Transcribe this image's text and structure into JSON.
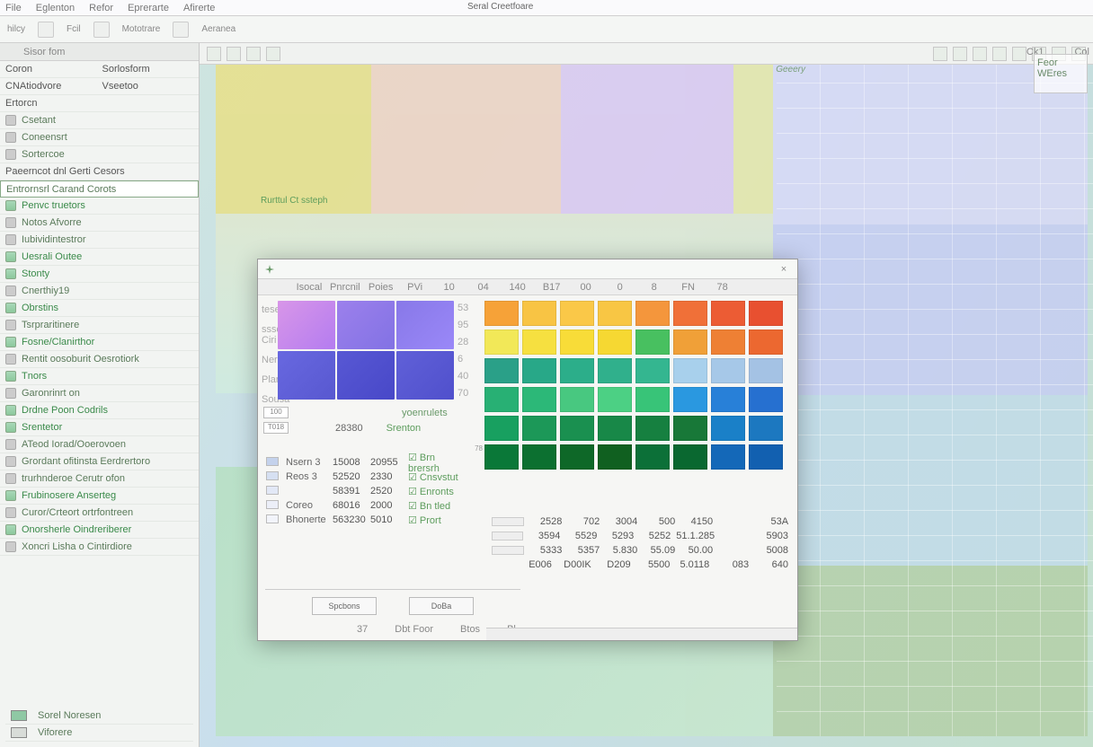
{
  "app_title": "Seral Creetfoare",
  "menu": [
    "File",
    "Eglenton",
    "Refor",
    "Eprerarte",
    "Afirerte"
  ],
  "toolbar_labels": [
    "Fcil",
    "Mototrare",
    "Aeranea"
  ],
  "leftpane": {
    "header": {
      "a": "Sisor fom",
      "b": ""
    },
    "pairs": [
      {
        "a": "Coron",
        "b": "Sorlosform"
      },
      {
        "a": "CNAtiodvore",
        "b": "Vseetoo"
      }
    ],
    "items": [
      {
        "label": "Ertorcn",
        "type": "hdr"
      },
      {
        "label": "Csetant",
        "icon": true
      },
      {
        "label": "Coneensrt",
        "icon": true
      },
      {
        "label": "Sortercoe",
        "icon": true
      },
      {
        "label": "Paeerncot dnl Gerti Cesors",
        "type": "hdr"
      },
      {
        "label": "Entrornsrl Carand Corots",
        "sel": true
      },
      {
        "label": "Penvc truetors",
        "green": true,
        "icon": true
      },
      {
        "label": "Notos Afvorre",
        "icon": true
      },
      {
        "label": "Iubividintestror",
        "icon": true
      },
      {
        "label": "Uesrali Outee",
        "green": true,
        "icon": true
      },
      {
        "label": "Stonty",
        "green": true,
        "icon": true
      },
      {
        "label": "Cnerthiy19",
        "icon": true
      },
      {
        "label": "Obrstins",
        "green": true,
        "icon": true
      },
      {
        "label": "Tsrpraritinere",
        "icon": true
      },
      {
        "label": "Fosne/Clanirthor",
        "green": true,
        "icon": true
      },
      {
        "label": "Rentit oosoburit Oesrotiork",
        "icon": true
      },
      {
        "label": "Tnors",
        "green": true,
        "icon": true
      },
      {
        "label": "Garonrinrt on",
        "icon": true
      },
      {
        "label": "Drdne Poon Codrils",
        "green": true,
        "icon": true
      },
      {
        "label": "Srentetor",
        "green": true,
        "icon": true
      },
      {
        "label": "ATeod Iorad/Ooerovoen",
        "icon": true
      },
      {
        "label": "Grordant ofitinsta Eerdrertoro",
        "icon": true
      },
      {
        "label": "trurhnderoe Cerutr ofon",
        "icon": true
      },
      {
        "label": "Frubinosere Anserteg",
        "green": true,
        "icon": true
      },
      {
        "label": "Curor/Crteort ortrfontreen",
        "icon": true
      },
      {
        "label": "Onorsherle Oindreriberer",
        "green": true,
        "icon": true
      },
      {
        "label": "Xoncri Lisha o Cintirdiore",
        "icon": true
      }
    ],
    "bottom": [
      {
        "label": "Sorel Noresen"
      },
      {
        "label": "Viforere"
      }
    ]
  },
  "rightmini": {
    "a": "Feor",
    "b": "WEres"
  },
  "catlabel": "Geeery",
  "colhdrs": [
    "Ck1",
    "Col"
  ],
  "sectag": "Rurttul Ct ssteph",
  "dialog": {
    "hdrcells": [
      "",
      "Isocal",
      "Pnrcnil",
      "Poies",
      "PVi",
      "10",
      "04",
      "140",
      "B17",
      "00",
      "0",
      "8",
      "FN",
      "78"
    ],
    "sidelabels": [
      "teserrol",
      "sssd Ciri",
      "Neres",
      "Plantel",
      "Sousa"
    ],
    "list_nums": [
      "53",
      "95",
      "28",
      "6",
      "40",
      "70"
    ],
    "optrow": {
      "v": "100",
      "hdr": "yoenrulets"
    },
    "btmhead": [
      "T018",
      "28380",
      "",
      "Srenton"
    ],
    "table": [
      {
        "sw": "#c4d2ec",
        "c1": "Nsern 3",
        "c2": "15008",
        "c3": "20955",
        "c4": "Brn brersrh"
      },
      {
        "sw": "#d6e0f2",
        "c1": "Reos 3",
        "c2": "52520",
        "c3": "2330",
        "c4": "Cnsvstut"
      },
      {
        "sw": "#e2e8f6",
        "c1": "",
        "c2": "58391",
        "c3": "2520",
        "c4": "Enronts"
      },
      {
        "sw": "#eceff8",
        "c1": "Coreo",
        "c2": "68016",
        "c3": "2000",
        "c4": "Bn tled"
      },
      {
        "sw": "#f2f4fa",
        "c1": "Bhonerte",
        "c2": "563230",
        "c3": "5010",
        "c4": "Prort"
      }
    ],
    "buttons": [
      "Spcbons",
      "DoBa"
    ],
    "buttons2": [
      "Dbt Foor",
      "",
      "Btos"
    ],
    "b2a": "37",
    "b2b": "Bl",
    "palette_row_labels": [
      "",
      "",
      "",
      "",
      "",
      "78"
    ],
    "palette": [
      [
        "#f6a238",
        "#f8c444",
        "#fac848",
        "#f8c644",
        "#f4963c",
        "#f07038",
        "#ec5c34",
        "#e85030"
      ],
      [
        "#f2e858",
        "#f6e040",
        "#f8dc38",
        "#f6d832",
        "#48c060",
        "#f0a038",
        "#ee8034",
        "#ec6830"
      ],
      [
        "#2aa088",
        "#28a888",
        "#2cae8a",
        "#30b08c",
        "#34b690",
        "#a8d0ec",
        "#a6c8e8",
        "#a4c2e4"
      ],
      [
        "#28b074",
        "#2cb878",
        "#48c880",
        "#4cd084",
        "#38c478",
        "#2a98e0",
        "#2880d8",
        "#2670d0"
      ],
      [
        "#18a060",
        "#1c9858",
        "#1a9050",
        "#188848",
        "#168040",
        "#187838",
        "#1a80c8",
        "#1c78c0"
      ],
      [
        "#0a7838",
        "#0c7030",
        "#0e6828",
        "#106020",
        "#0c7038",
        "#0a6830",
        "#1468b8",
        "#1260b0"
      ]
    ],
    "numtbl": [
      [
        "2528",
        "702",
        "3004",
        "500",
        "4150",
        "",
        "53A"
      ],
      [
        "3594",
        "5529",
        "5293",
        "5252",
        "51.1.285",
        "",
        "5903"
      ],
      [
        "5333",
        "5357",
        "5.830",
        "55.09",
        "50.00",
        "",
        "5008"
      ],
      [
        "E006",
        "D00IK",
        "D209",
        "5500",
        "5.0118",
        "083",
        "640"
      ]
    ]
  }
}
